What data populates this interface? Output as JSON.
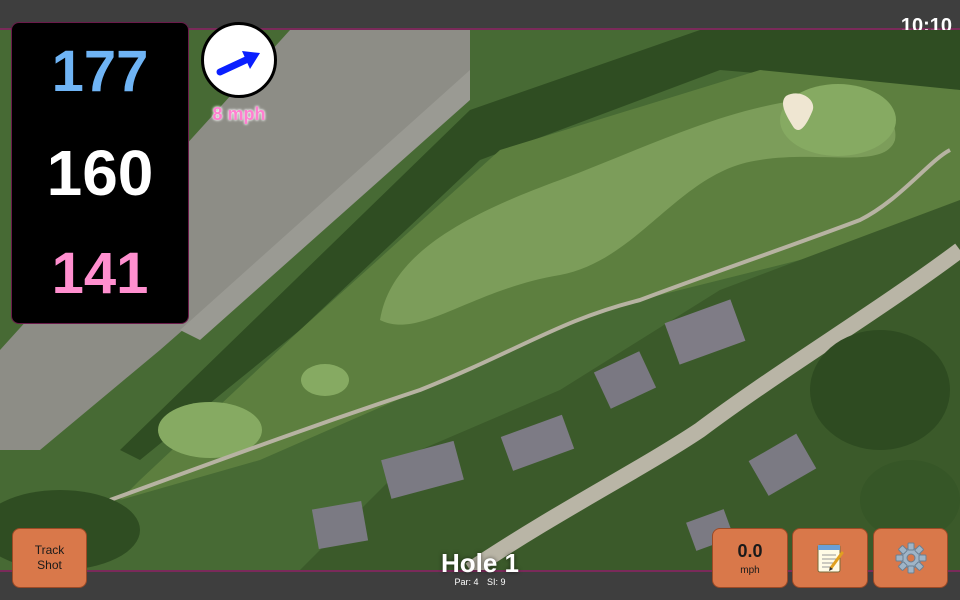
{
  "status": {
    "clock": "10:10"
  },
  "distances": {
    "back": "177",
    "middle": "160",
    "front": "141"
  },
  "wind": {
    "speed_label": "8 mph",
    "arrow_icon": "wind-direction-arrow-icon",
    "direction": "east-northeast"
  },
  "hole": {
    "title": "Hole 1",
    "par": "Par: 4",
    "si": "SI: 9"
  },
  "buttons": {
    "track_shot_line1": "Track",
    "track_shot_line2": "Shot",
    "speed_value": "0.0",
    "speed_unit": "mph",
    "notes_icon": "notepad-icon",
    "settings_icon": "gear-icon"
  },
  "colors": {
    "back": "#6fb4f5",
    "middle": "#ffffff",
    "front": "#ff8fcf",
    "button": "#d9784a",
    "accent": "#7a2a5a"
  }
}
